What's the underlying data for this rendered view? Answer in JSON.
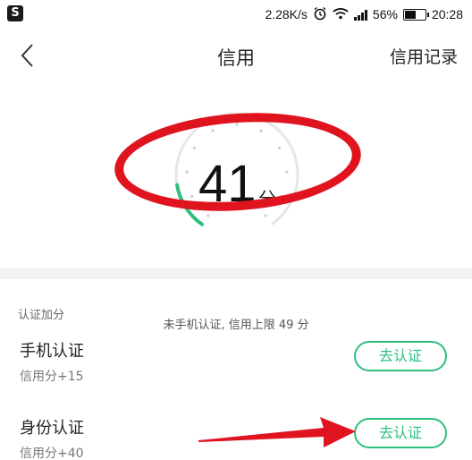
{
  "status_bar": {
    "app_icon": "S",
    "speed": "2.28K/s",
    "battery_pct": "56%",
    "battery_level": 0.56,
    "time": "20:28",
    "icons": [
      "alarm-icon",
      "wifi-icon",
      "signal-icon",
      "battery-icon"
    ]
  },
  "header": {
    "back_icon": "chevron-left-icon",
    "title": "信用",
    "record_link": "信用记录"
  },
  "score": {
    "value": "41",
    "unit": "分",
    "hint": "未手机认证, 信用上限 49 分",
    "gauge_fraction": 0.41,
    "accent_color": "#2fbf7c"
  },
  "cert_section": {
    "label": "认证加分",
    "items": [
      {
        "title": "手机认证",
        "bonus": "信用分+15",
        "button": "去认证"
      },
      {
        "title": "身份认证",
        "bonus": "信用分+40",
        "button": "去认证"
      }
    ]
  },
  "annotation_color": "#e0141e"
}
